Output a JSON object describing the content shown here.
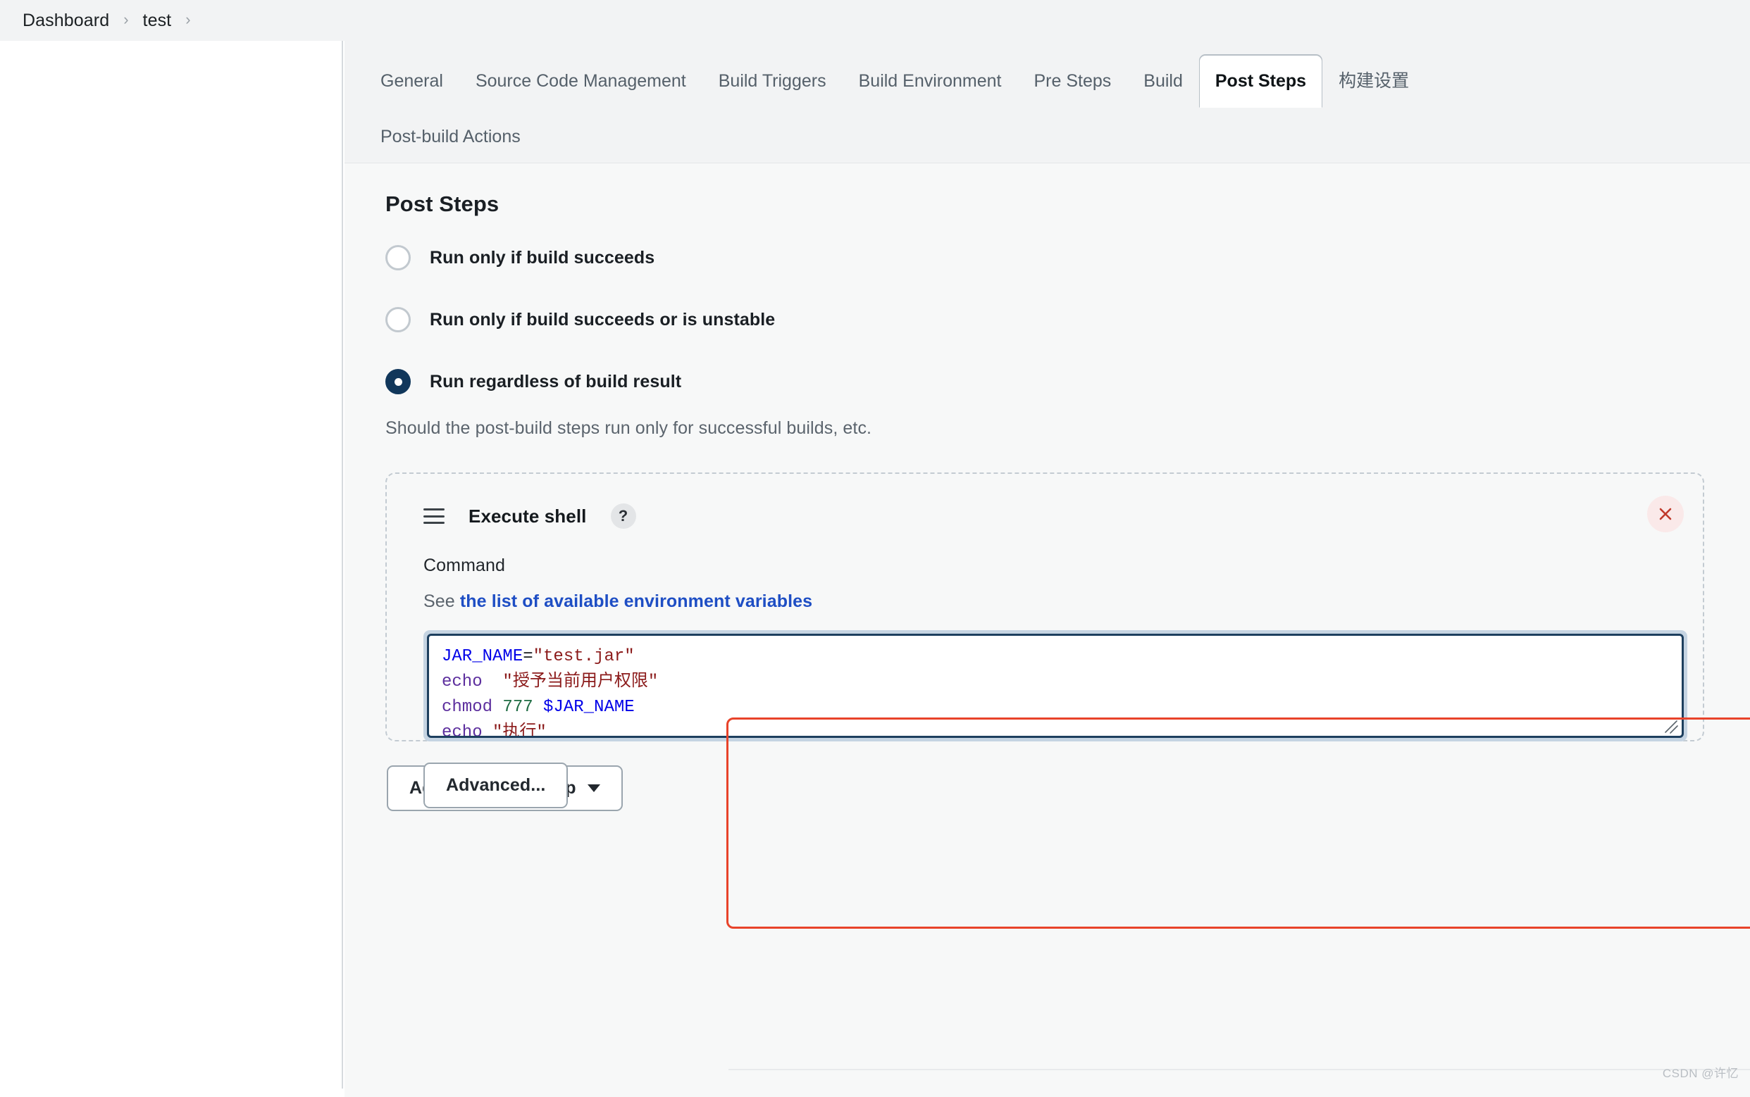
{
  "breadcrumb": {
    "items": [
      {
        "label": "Dashboard"
      },
      {
        "label": "test"
      }
    ],
    "separator": "›"
  },
  "tabs": {
    "row1": [
      {
        "label": "General",
        "active": false
      },
      {
        "label": "Source Code Management",
        "active": false
      },
      {
        "label": "Build Triggers",
        "active": false
      },
      {
        "label": "Build Environment",
        "active": false
      },
      {
        "label": "Pre Steps",
        "active": false
      },
      {
        "label": "Build",
        "active": false
      },
      {
        "label": "Post Steps",
        "active": true
      },
      {
        "label": "构建设置",
        "active": false
      }
    ],
    "row2": [
      {
        "label": "Post-build Actions",
        "active": false
      }
    ]
  },
  "main": {
    "section_title": "Post Steps",
    "radios": [
      {
        "label": "Run only if build succeeds",
        "checked": false
      },
      {
        "label": "Run only if build succeeds or is unstable",
        "checked": false
      },
      {
        "label": "Run regardless of build result",
        "checked": true
      }
    ],
    "helper_text": "Should the post-build steps run only for successful builds, etc.",
    "step": {
      "title": "Execute shell",
      "help_icon": "?",
      "drag_handle_icon": "drag-handle-icon",
      "delete_icon": "close-icon",
      "field_label": "Command",
      "env_prefix": "See ",
      "env_link": "the list of available environment variables",
      "command_lines": [
        [
          {
            "t": "JAR_NAME",
            "c": "var"
          },
          {
            "t": "=",
            "c": "op"
          },
          {
            "t": "\"test.jar\"",
            "c": "str"
          }
        ],
        [
          {
            "t": "echo",
            "c": "cmd"
          },
          {
            "t": "  ",
            "c": "plain"
          },
          {
            "t": "\"授予当前用户权限\"",
            "c": "str"
          }
        ],
        [
          {
            "t": "chmod",
            "c": "cmd"
          },
          {
            "t": " ",
            "c": "plain"
          },
          {
            "t": "777",
            "c": "num"
          },
          {
            "t": " ",
            "c": "plain"
          },
          {
            "t": "$JAR_NAME",
            "c": "var"
          }
        ],
        [
          {
            "t": "echo",
            "c": "cmd"
          },
          {
            "t": " ",
            "c": "plain"
          },
          {
            "t": "\"执行\"",
            "c": "str"
          }
        ]
      ],
      "command_raw": "JAR_NAME=\"test.jar\"\necho  \"授予当前用户权限\"\nchmod 777 $JAR_NAME\necho \"执行\"",
      "advanced_label": "Advanced..."
    },
    "add_step_label": "Add post-build step"
  },
  "watermark": "CSDN @许忆",
  "colors": {
    "accent_selected": "#11375b",
    "link": "#1e4ec4",
    "annotation": "#e8432a",
    "delete": "#c0392b",
    "editor_border": "#1d3f5e",
    "page_bg": "#f7f8f8",
    "bar_bg": "#f2f3f4"
  }
}
